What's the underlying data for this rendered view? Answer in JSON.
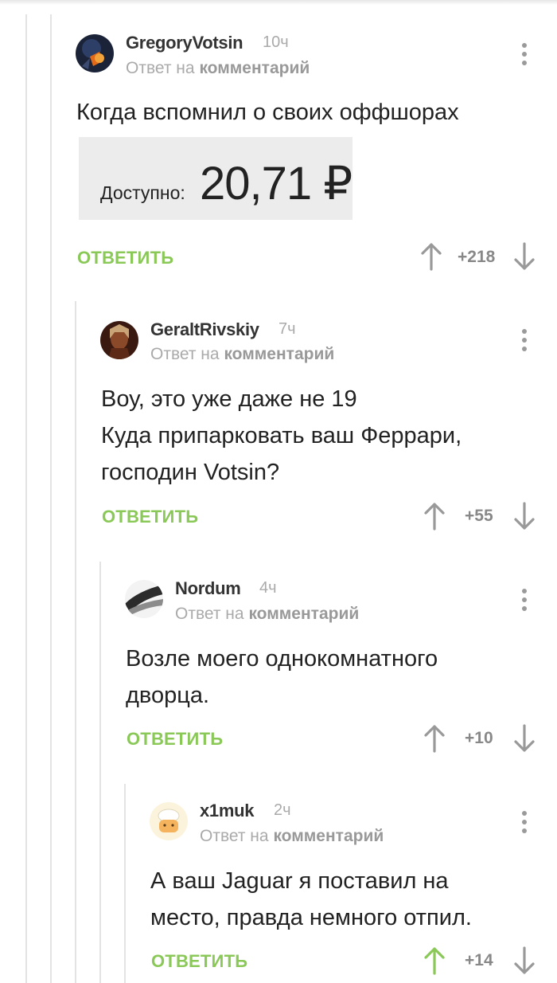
{
  "common": {
    "reply_prefix": "Ответ на",
    "reply_target": "комментарий",
    "reply_button": "ОТВЕТИТЬ"
  },
  "comments": [
    {
      "username": "GregoryVotsin",
      "time": "10ч",
      "text": "Когда вспомнил о своих оффшорах",
      "attachment": {
        "label": "Доступно:",
        "amount": "20,71 ₽"
      },
      "score": "+218"
    },
    {
      "username": "GeraltRivskiy",
      "time": "7ч",
      "text_lines": [
        "Воу, это уже даже не 19",
        "Куда припарковать ваш Феррари,",
        "господин Votsin?"
      ],
      "score": "+55"
    },
    {
      "username": "Nordum",
      "time": "4ч",
      "text_lines": [
        "Возле моего однокомнатного",
        "дворца."
      ],
      "score": "+10"
    },
    {
      "username": "x1muk",
      "time": "2ч",
      "text_lines": [
        "А ваш Jaguar я поставил на",
        "место, правда немного отпил."
      ],
      "score": "+14",
      "upvoted": true
    }
  ],
  "colors": {
    "accent_green": "#8ac858",
    "vote_arrow": "#999999"
  }
}
